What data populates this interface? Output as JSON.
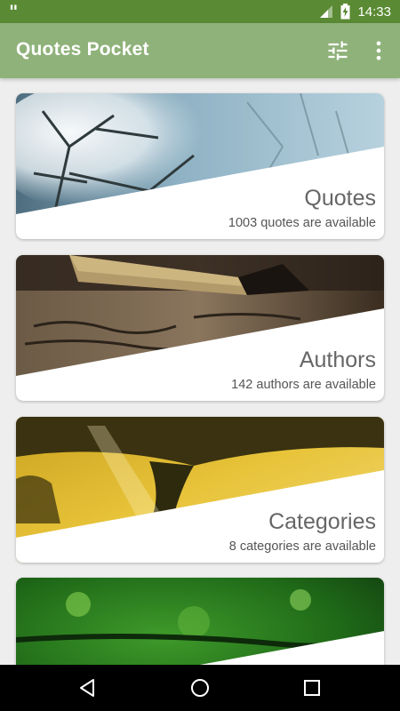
{
  "status_bar": {
    "time": "14:33",
    "icons": [
      "quote-notification-icon",
      "signal-icon",
      "battery-charging-icon"
    ]
  },
  "app_bar": {
    "title": "Quotes Pocket",
    "icons": [
      "tune-icon",
      "more-vert-icon"
    ]
  },
  "cards": [
    {
      "title": "Quotes",
      "subtitle": "1003 quotes are available",
      "image": "snowy-tree-photo"
    },
    {
      "title": "Authors",
      "subtitle": "142 authors are available",
      "image": "fountain-pen-photo"
    },
    {
      "title": "Categories",
      "subtitle": "8 categories are available",
      "image": "sunlit-tree-photo"
    },
    {
      "title": "",
      "subtitle": "",
      "image": "green-foliage-photo"
    }
  ],
  "nav_bar": {
    "icons": [
      "back-icon",
      "home-icon",
      "recents-icon"
    ]
  }
}
